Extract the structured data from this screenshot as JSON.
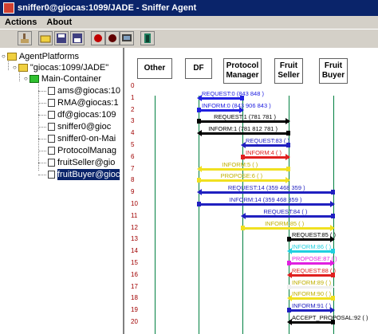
{
  "window": {
    "title": "sniffer0@giocas:1099/JADE - Sniffer Agent"
  },
  "menu": {
    "items": [
      "Actions",
      "About"
    ]
  },
  "toolbar": {
    "buttons": [
      "clear-canvas",
      "open-file",
      "save-file",
      "save-text",
      "start-sniff",
      "stop-sniff",
      "show-only",
      "exit"
    ]
  },
  "tree": {
    "root": "AgentPlatforms",
    "platform": "\"giocas:1099/JADE\"",
    "container": "Main-Container",
    "agents": [
      "ams@giocas:10",
      "RMA@giocas:1",
      "df@giocas:109",
      "sniffer0@gioc",
      "sniffer0-on-Mai",
      "ProtocolManag",
      "fruitSeller@gio",
      "fruitBuyer@gioc"
    ],
    "selected_index": 7
  },
  "sniffer": {
    "columns": [
      "Other",
      "DF",
      "Protocol\nManager",
      "Fruit\nSeller",
      "Fruit\nBuyer"
    ],
    "row_numbers": [
      "0",
      "1",
      "2",
      "3",
      "4",
      "5",
      "6",
      "7",
      "8",
      "9",
      "10",
      "11",
      "12",
      "13",
      "14",
      "15",
      "16",
      "17",
      "18",
      "19",
      "20"
    ],
    "messages": [
      {
        "label": "REQUEST:0 (843  848  )",
        "from": 2,
        "to": 1,
        "color": "#2020e0"
      },
      {
        "label": "INFORM:0 (843  906  843  )",
        "from": 1,
        "to": 2,
        "color": "#2020e0"
      },
      {
        "label": "REQUEST:1 (781  781  )",
        "from": 1,
        "to": 3,
        "color": "#000000"
      },
      {
        "label": "INFORM:1 (781  812  781  )",
        "from": 3,
        "to": 1,
        "color": "#000000"
      },
      {
        "label": "REQUEST:83 (     )",
        "from": 3,
        "to": 2,
        "color": "#2020c0"
      },
      {
        "label": "INFORM:4 (     )",
        "from": 2,
        "to": 3,
        "color": "#e02020"
      },
      {
        "label": "INFORM:5 (     )",
        "from": 3,
        "to": 1,
        "color": "#f0e020"
      },
      {
        "label": "PROPOSE:6 (     )",
        "from": 1,
        "to": 3,
        "color": "#f0e020"
      },
      {
        "label": "REQUEST:14 (359  468  359  )",
        "from": 4,
        "to": 1,
        "color": "#2020c0"
      },
      {
        "label": "INFORM:14 (359  468  359  )",
        "from": 1,
        "to": 4,
        "color": "#2020c0"
      },
      {
        "label": "REQUEST:84 (     )",
        "from": 4,
        "to": 2,
        "color": "#2020c0"
      },
      {
        "label": "INFORM:85 (     )",
        "from": 2,
        "to": 4,
        "color": "#f0e020"
      },
      {
        "label": "REQUEST:85 (     )",
        "from": 3,
        "to": 4,
        "color": "#000000"
      },
      {
        "label": "INFORM:86 (     )",
        "from": 4,
        "to": 3,
        "color": "#20d0e0"
      },
      {
        "label": "PROPOSE:87 (     )",
        "from": 3,
        "to": 4,
        "color": "#e020e0"
      },
      {
        "label": "REQUEST:88 (     )",
        "from": 4,
        "to": 3,
        "color": "#e02020"
      },
      {
        "label": "INFORM:89 (     )",
        "from": 3,
        "to": 4,
        "color": "#f0f0f0"
      },
      {
        "label": "INFORM:90 (     )",
        "from": 4,
        "to": 3,
        "color": "#f0e020"
      },
      {
        "label": "INFORM:91 (     )",
        "from": 3,
        "to": 4,
        "color": "#2020c0"
      },
      {
        "label": "ACCEPT_PROPOSAL:92 (     )",
        "from": 4,
        "to": 3,
        "color": "#000000"
      }
    ]
  }
}
